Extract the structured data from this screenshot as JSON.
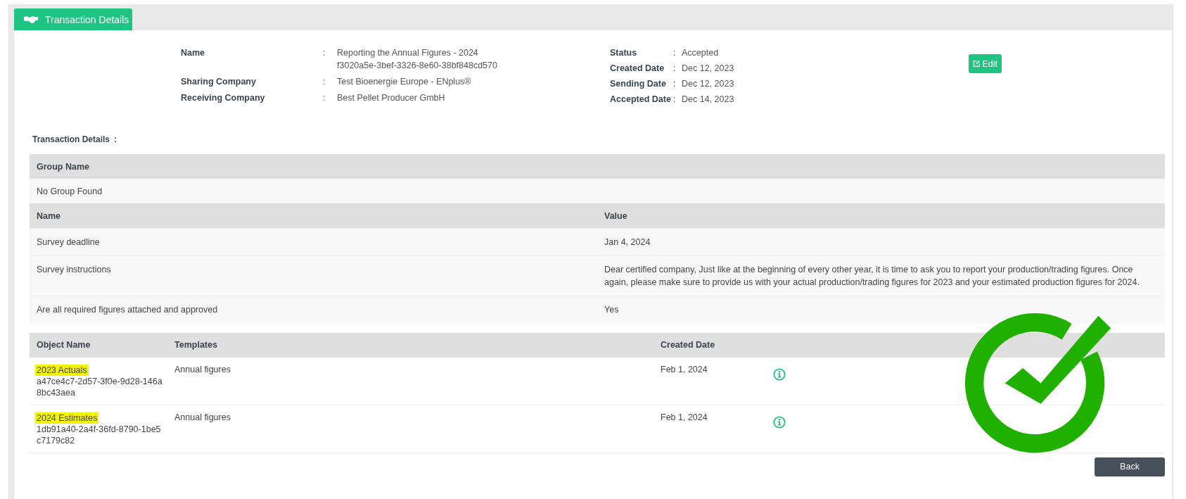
{
  "tab": {
    "label": "Transaction Details",
    "selected": true
  },
  "details_left": [
    {
      "label": "Name",
      "separator": ":",
      "lines": [
        "Reporting the Annual Figures - 2024",
        "f3020a5e-3bef-3326-8e60-38bf848cd570"
      ]
    },
    {
      "label": "Sharing Company",
      "separator": ":",
      "lines": [
        "Test Bioenergie Europe - ENplus®"
      ]
    },
    {
      "label": "Receiving Company",
      "separator": ":",
      "lines": [
        "Best Pellet Producer GmbH"
      ]
    }
  ],
  "details_right": [
    {
      "label": "Status",
      "separator": ":",
      "value": "Accepted"
    },
    {
      "label": "Created Date",
      "separator": ":",
      "value": "Dec 12, 2023"
    },
    {
      "label": "Sending Date",
      "separator": ":",
      "value": "Dec 12, 2023"
    },
    {
      "label": "Accepted Date",
      "separator": ":",
      "value": "Dec 14, 2023"
    }
  ],
  "edit_button": "Edit",
  "section_title": {
    "text": "Transaction Details",
    "separator": ":"
  },
  "group_table": {
    "header": "Group Name",
    "rows": [
      "No Group Found"
    ]
  },
  "attributes_table": {
    "columns": [
      "Name",
      "Value"
    ],
    "rows": [
      {
        "name": "Survey deadline",
        "value": "Jan 4, 2024"
      },
      {
        "name": "Survey instructions",
        "value": "Dear certified company, Just like at the beginning of every other year, it is time to ask you to report your production/trading figures. Once again, please make sure to provide us with your actual production/trading figures for 2023 and your estimated production figures for 2024."
      },
      {
        "name": "Are all required figures attached and approved",
        "value": "Yes"
      }
    ]
  },
  "objects_table": {
    "columns": [
      "Object Name",
      "Templates",
      "Created Date"
    ],
    "rows": [
      {
        "name": "2023 Actuals",
        "highlighted": true,
        "id": "a47ce4c7-2d57-3f0e-9d28-146a8bc43aea",
        "template": "Annual figures",
        "created": "Feb 1, 2024"
      },
      {
        "name": "2024 Estimates",
        "highlighted": true,
        "id": "1db91a40-2a4f-36fd-8790-1be5c7179c82",
        "template": "Annual figures",
        "created": "Feb 1, 2024"
      }
    ]
  },
  "back_button": "Back"
}
